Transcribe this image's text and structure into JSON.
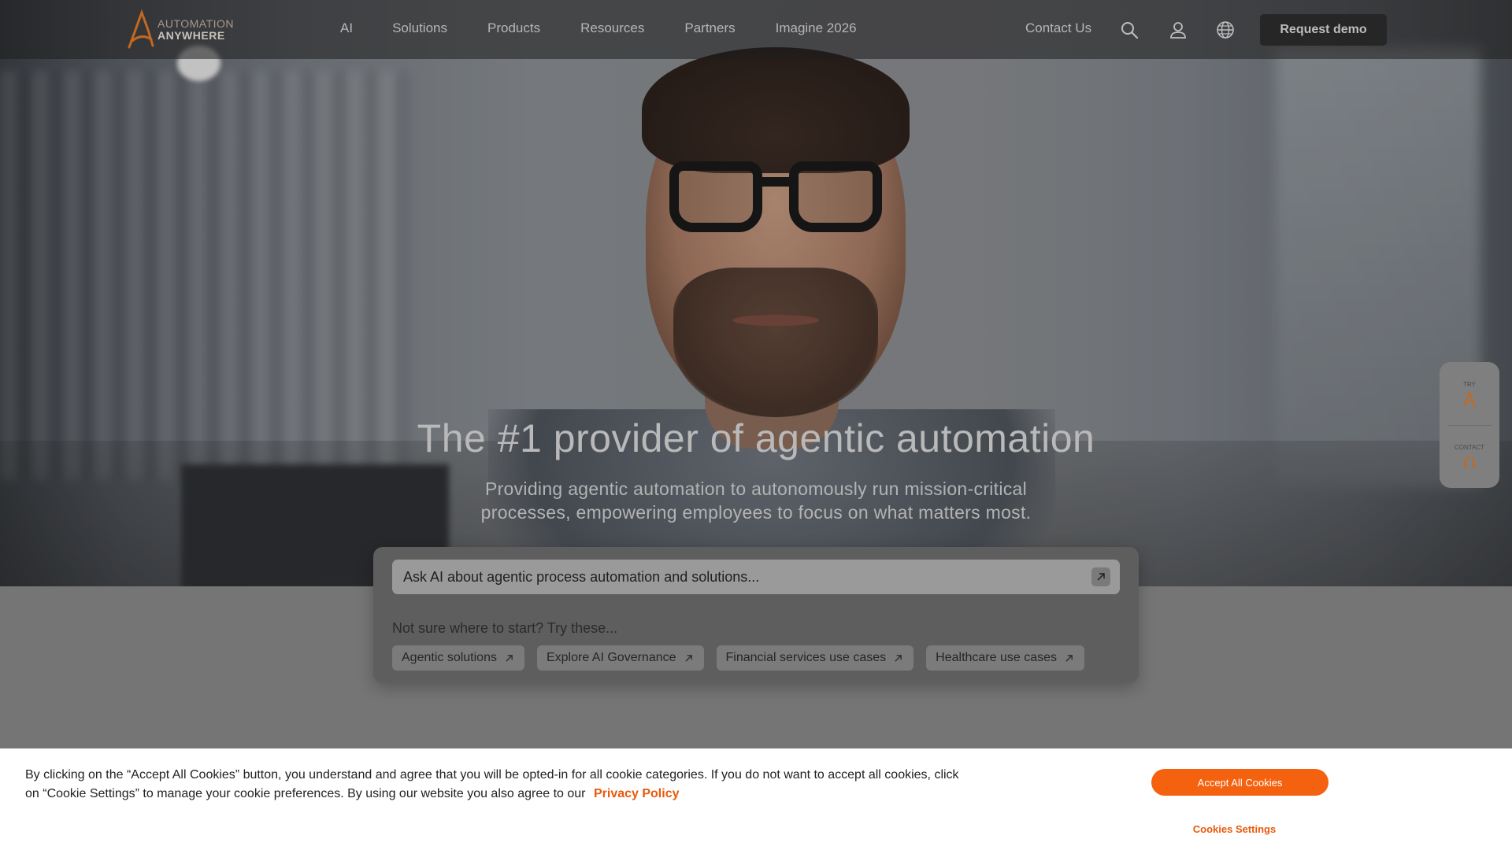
{
  "brand": {
    "line1": "AUTOMATION",
    "line2": "ANYWHERE",
    "accent": "#f5620f"
  },
  "nav": {
    "links": [
      "AI",
      "Solutions",
      "Products",
      "Resources",
      "Partners",
      "Imagine 2026"
    ],
    "contact": "Contact Us",
    "icons": [
      "search-icon",
      "user-icon",
      "globe-icon"
    ],
    "cta": "Request demo"
  },
  "hero": {
    "headline": "The #1 provider of agentic automation",
    "subheadline": "Providing agentic automation to autonomously run mission-critical processes, empowering employees to focus on what matters most."
  },
  "ai_card": {
    "input_placeholder": "Ask AI about agentic process automation and solutions...",
    "prompt_label": "Not sure where to start? Try these...",
    "chips": [
      "Agentic solutions",
      "Explore AI Governance",
      "Financial services use cases",
      "Healthcare use cases"
    ]
  },
  "side_widget": {
    "try_label": "TRY",
    "contact_label": "CONTACT"
  },
  "cookie_banner": {
    "text": "By clicking on the “Accept All Cookies” button, you understand and agree that you will be opted-in for all cookie categories. If you do not want to accept all cookies, click on “Cookie Settings” to manage your cookie preferences. By using our website you also agree to our",
    "privacy_link": "Privacy Policy",
    "accept": "Accept All Cookies",
    "settings": "Cookies Settings"
  }
}
